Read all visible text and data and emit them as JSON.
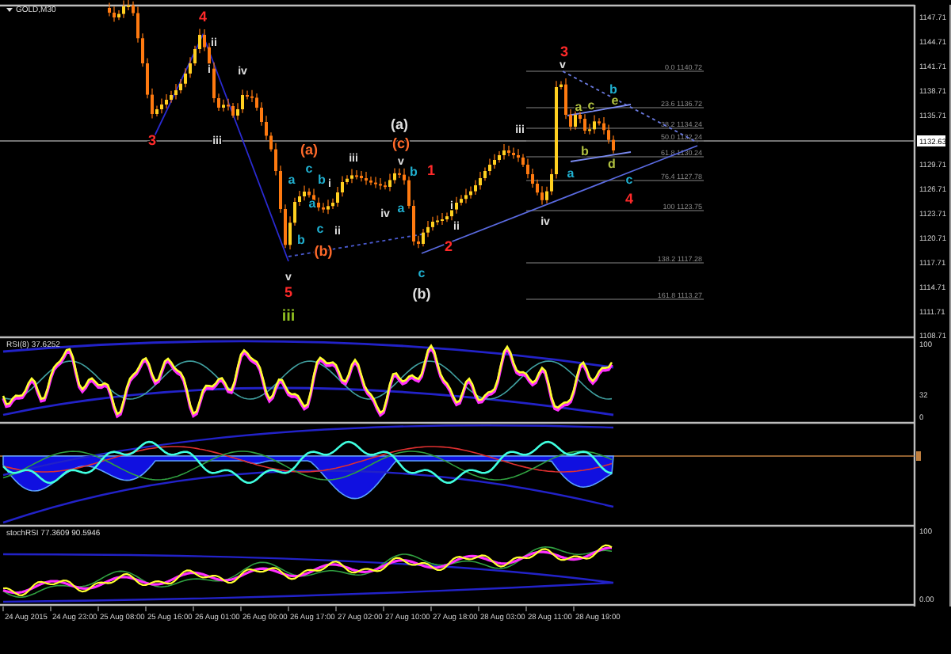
{
  "chart": {
    "symbol": "GOLD,M30",
    "price_axis": [
      "1147.71",
      "1144.71",
      "1141.71",
      "1138.71",
      "1135.71",
      "1129.71",
      "1126.71",
      "1123.71",
      "1120.71",
      "1117.71",
      "1114.71",
      "1111.71",
      "1108.71"
    ],
    "current_price": "1132.63",
    "fibonacci_levels": [
      "0.0 1140.72",
      "23.6 1136.72",
      "38.2 1134.24",
      "50.0 1132.24",
      "61.8 1130.24",
      "76.4 1127.78",
      "100 1123.75",
      "138.2 1117.28",
      "161.8 1113.27"
    ],
    "wave_labels": [
      {
        "text": "4",
        "color": "#ff2a2a"
      },
      {
        "text": "ii",
        "color": "#e0e0e0"
      },
      {
        "text": "3",
        "color": "#ff2a2a"
      },
      {
        "text": "i",
        "color": "#e0e0e0"
      },
      {
        "text": "iv",
        "color": "#e0e0e0"
      },
      {
        "text": "v",
        "color": "#e0e0e0"
      },
      {
        "text": "b",
        "color": "#20b0d0"
      },
      {
        "text": "a",
        "color": "#b0c040"
      },
      {
        "text": "c",
        "color": "#b0c040"
      },
      {
        "text": "e",
        "color": "#b0c040"
      },
      {
        "text": "(a)",
        "color": "#e0e0e0"
      },
      {
        "text": "iii",
        "color": "#e0e0e0"
      },
      {
        "text": "3",
        "color": "#ff2a2a"
      },
      {
        "text": "iii",
        "color": "#e0e0e0"
      },
      {
        "text": "(c)",
        "color": "#ff6a2a"
      },
      {
        "text": "(a)",
        "color": "#ff6a2a"
      },
      {
        "text": "b",
        "color": "#b0c040"
      },
      {
        "text": "iii",
        "color": "#e0e0e0"
      },
      {
        "text": "v",
        "color": "#e0e0e0"
      },
      {
        "text": "d",
        "color": "#b0c040"
      },
      {
        "text": "c",
        "color": "#20b0d0"
      },
      {
        "text": "b",
        "color": "#20b0d0"
      },
      {
        "text": "1",
        "color": "#ff2a2a"
      },
      {
        "text": "a",
        "color": "#20b0d0"
      },
      {
        "text": "a",
        "color": "#20b0d0"
      },
      {
        "text": "b",
        "color": "#20b0d0"
      },
      {
        "text": "i",
        "color": "#e0e0e0"
      },
      {
        "text": "c",
        "color": "#20b0d0"
      },
      {
        "text": "4",
        "color": "#ff2a2a"
      },
      {
        "text": "a",
        "color": "#20b0d0"
      },
      {
        "text": "iv",
        "color": "#e0e0e0"
      },
      {
        "text": "a",
        "color": "#20b0d0"
      },
      {
        "text": "i",
        "color": "#e0e0e0"
      },
      {
        "text": "c",
        "color": "#20b0d0"
      },
      {
        "text": "ii",
        "color": "#e0e0e0"
      },
      {
        "text": "ii",
        "color": "#e0e0e0"
      },
      {
        "text": "iv",
        "color": "#e0e0e0"
      },
      {
        "text": "b",
        "color": "#20b0d0"
      },
      {
        "text": "2",
        "color": "#ff2a2a"
      },
      {
        "text": "(b)",
        "color": "#ff6a2a"
      },
      {
        "text": "v",
        "color": "#e0e0e0"
      },
      {
        "text": "c",
        "color": "#20b0d0"
      },
      {
        "text": "5",
        "color": "#ff2a2a"
      },
      {
        "text": "(b)",
        "color": "#e0e0e0"
      },
      {
        "text": "iii",
        "color": "#90c020"
      }
    ]
  },
  "indicator_panels": [
    {
      "kind": "rsi",
      "label": "RSI(8) 37.6252",
      "axis": [
        "100",
        "32",
        "0"
      ]
    },
    {
      "kind": "histogram"
    },
    {
      "kind": "stoch",
      "label": "stochRSI 77.3609 90.5946",
      "axis": [
        "100",
        "0.00"
      ]
    }
  ],
  "time_axis": [
    "24 Aug 2015",
    "24 Aug 23:00",
    "25 Aug 08:00",
    "25 Aug 16:00",
    "26 Aug 01:00",
    "26 Aug 09:00",
    "26 Aug 17:00",
    "27 Aug 02:00",
    "27 Aug 10:00",
    "27 Aug 18:00",
    "28 Aug 03:00",
    "28 Aug 11:00",
    "28 Aug 19:00"
  ]
}
